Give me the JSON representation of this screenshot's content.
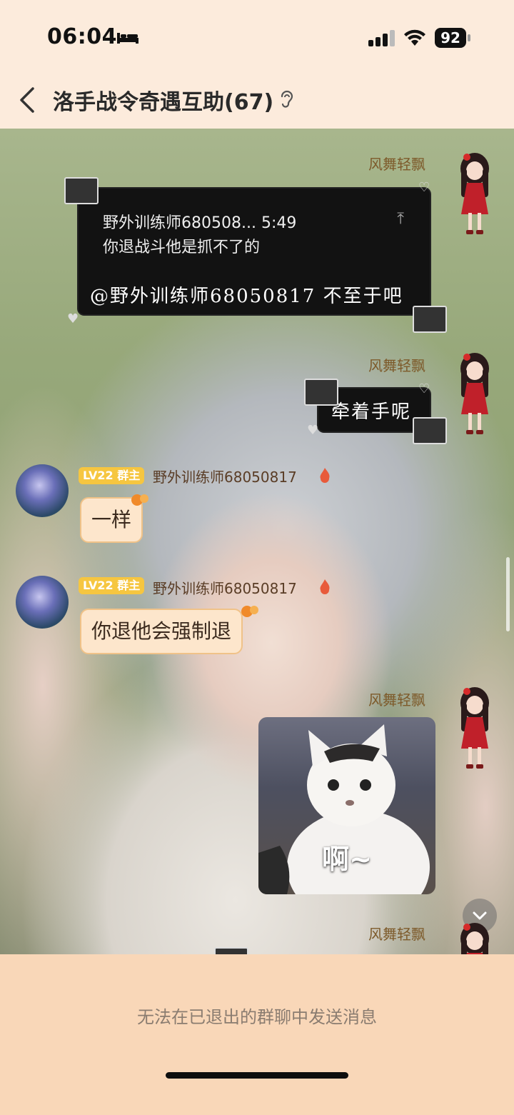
{
  "status": {
    "time": "06:04",
    "battery": "92"
  },
  "header": {
    "title": "洛手战令奇遇互助(67)"
  },
  "messages": {
    "sender1": "风舞轻飘",
    "quote_head": "野外训练师680508... 5:49",
    "quote_body": "你退战斗他是抓不了的",
    "reply_text": "@野外训练师68050817 不至于吧",
    "sender2": "风舞轻飘",
    "sticker2_text": "牵着手呢",
    "member1_level": "LV22 群主",
    "member1_name": "野外训练师68050817",
    "member1_msg": "一样",
    "member2_level": "LV22 群主",
    "member2_name": "野外训练师68050817",
    "member2_msg": "你退他会强制退",
    "sender3": "风舞轻飘",
    "cat_caption": "啊~",
    "sender4": "风舞轻飘"
  },
  "footer": {
    "notice": "无法在已退出的群聊中发送消息"
  },
  "icons": {
    "back": "chevron-left-icon",
    "ear": "ear-icon",
    "scroll": "chevron-down-icon"
  }
}
